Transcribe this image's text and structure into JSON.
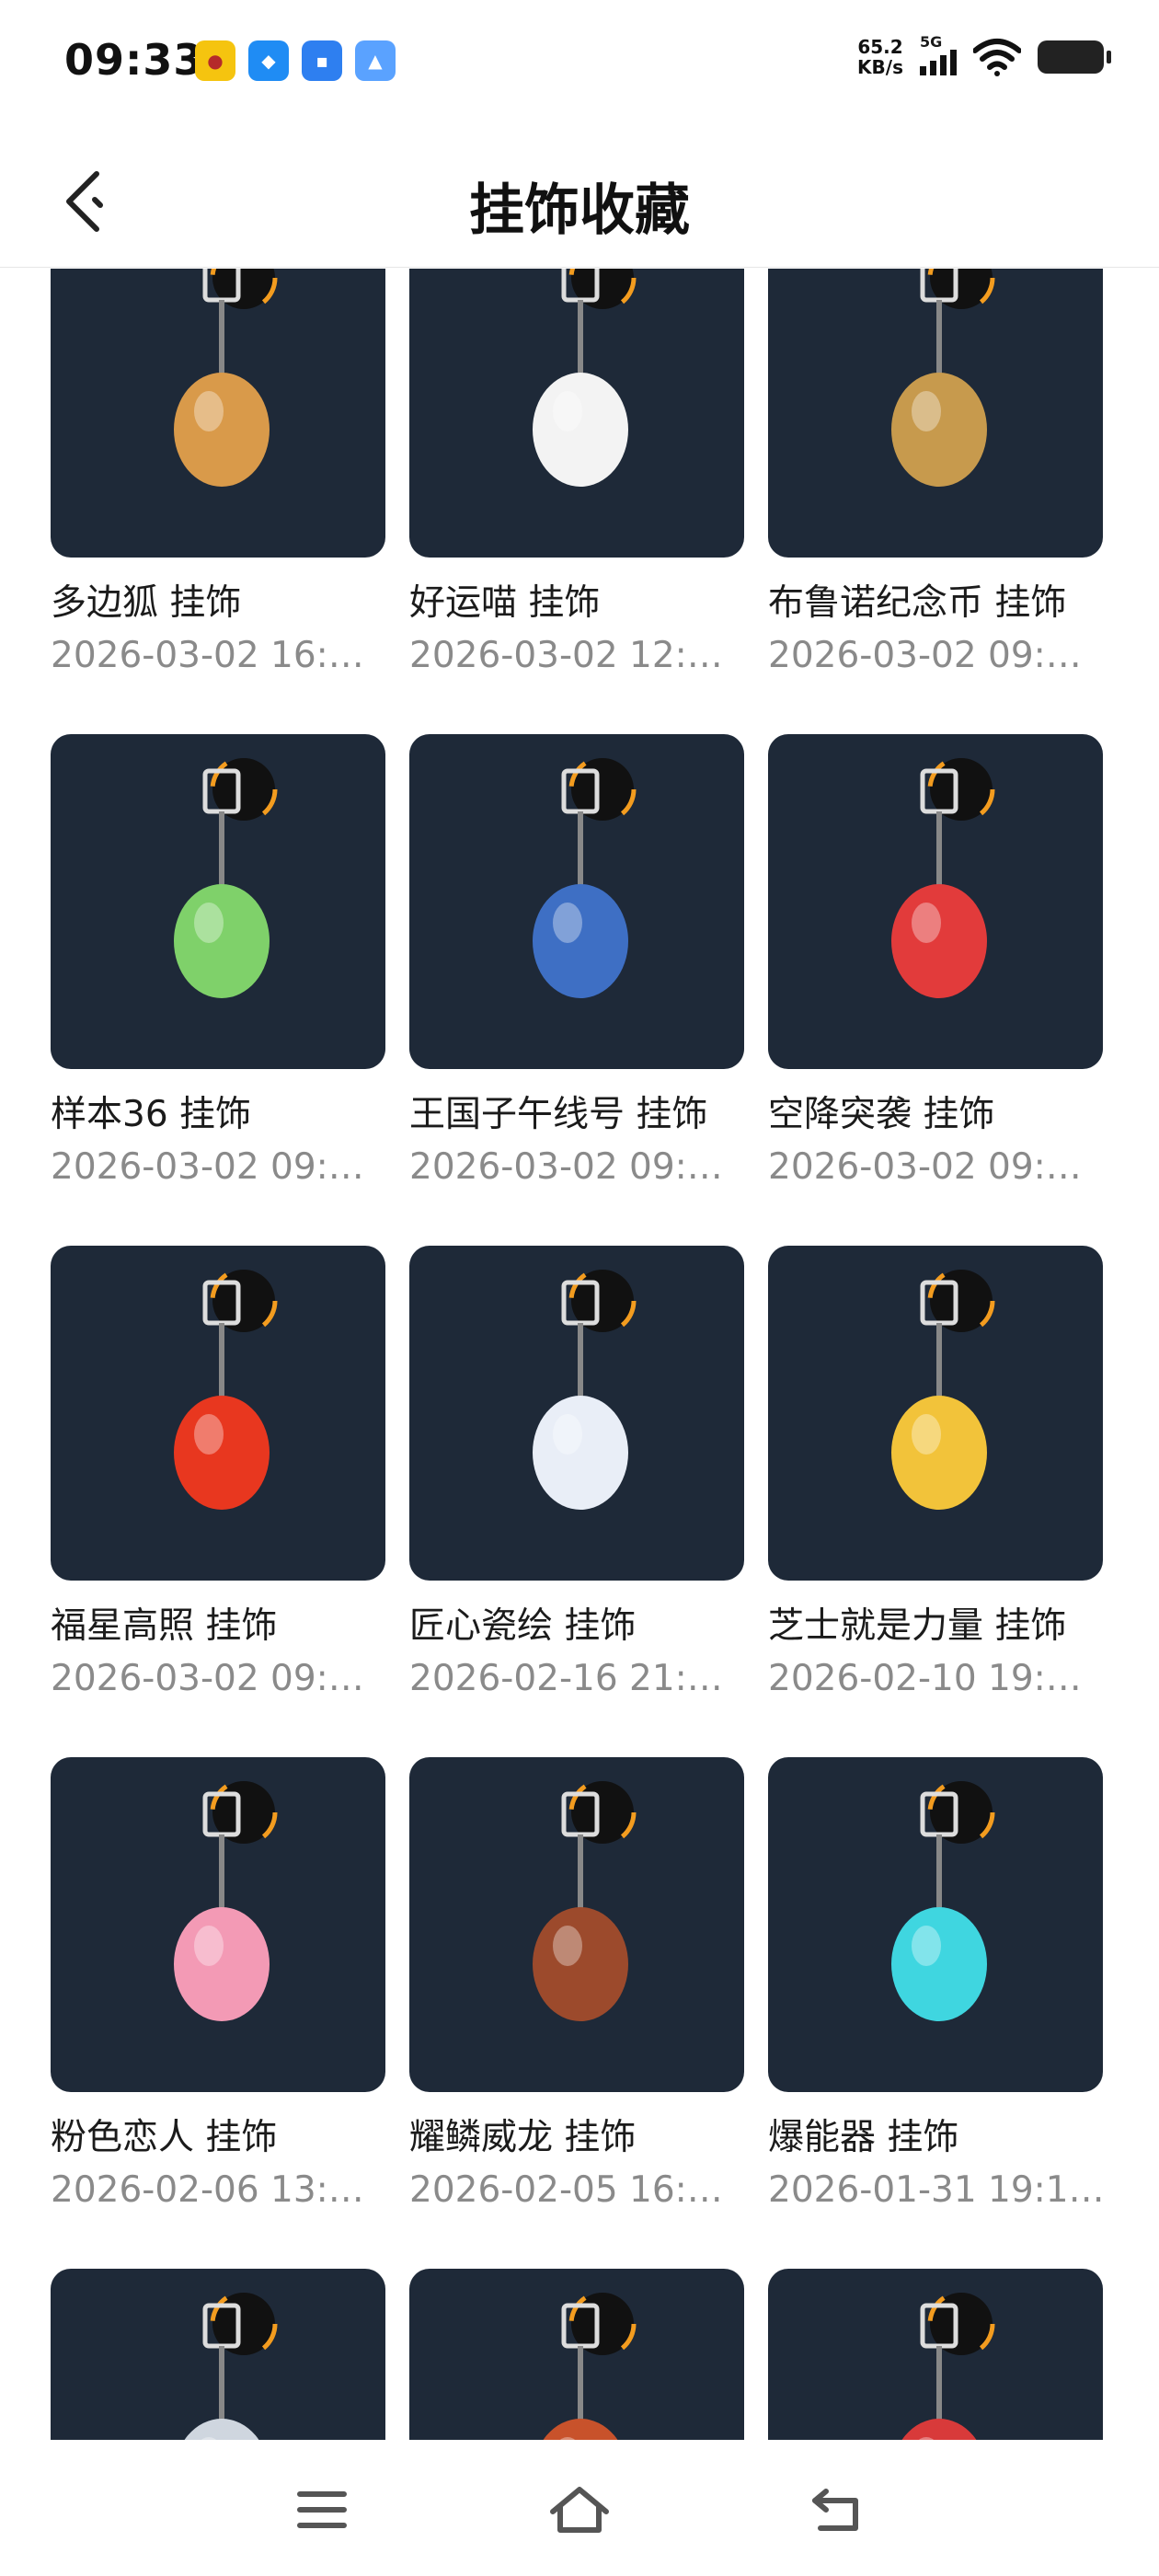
{
  "status_bar": {
    "time": "09:33",
    "net_speed_value": "65.2",
    "net_speed_unit": "KB/s",
    "network_label": "5G",
    "app_icons": [
      "game-app-icon",
      "du-app-icon",
      "chat-app-icon",
      "files-app-icon"
    ]
  },
  "header": {
    "title": "挂饰收藏",
    "back_icon": "back-arrow-icon"
  },
  "items": [
    {
      "name": "多边狐 挂饰",
      "time": "2026-03-02 16:…",
      "color": "#d99a4a"
    },
    {
      "name": "好运喵 挂饰",
      "time": "2026-03-02 12:…",
      "color": "#f3f3f3"
    },
    {
      "name": "布鲁诺纪念币 挂饰",
      "time": "2026-03-02 09:…",
      "color": "#c79a4d"
    },
    {
      "name": "样本36 挂饰",
      "time": "2026-03-02 09:…",
      "color": "#7fd16a"
    },
    {
      "name": "王国子午线号 挂饰",
      "time": "2026-03-02 09:…",
      "color": "#3e6fc4"
    },
    {
      "name": "空降突袭 挂饰",
      "time": "2026-03-02 09:…",
      "color": "#e23b3b"
    },
    {
      "name": "福星高照 挂饰",
      "time": "2026-03-02 09:…",
      "color": "#e8371f"
    },
    {
      "name": "匠心瓷绘 挂饰",
      "time": "2026-02-16 21:…",
      "color": "#e9eef7"
    },
    {
      "name": "芝士就是力量 挂饰",
      "time": "2026-02-10 19:…",
      "color": "#f2c33a"
    },
    {
      "name": "粉色恋人 挂饰",
      "time": "2026-02-06 13:…",
      "color": "#f39ab5"
    },
    {
      "name": "耀鳞威龙 挂饰",
      "time": "2026-02-05 16:…",
      "color": "#9c4a2c"
    },
    {
      "name": "爆能器 挂饰",
      "time": "2026-01-31 19:1…",
      "color": "#3fd6e0"
    },
    {
      "name": "",
      "time": "",
      "color": "#cfd6df"
    },
    {
      "name": "",
      "time": "",
      "color": "#c8522b"
    },
    {
      "name": "",
      "time": "",
      "color": "#d83a3a"
    }
  ],
  "nav": {
    "menu_icon": "menu-icon",
    "home_icon": "home-icon",
    "back_icon": "back-icon"
  },
  "colors": {
    "card_bg": "#1e2938",
    "accent_ring": "#f39c1f",
    "secondary_text": "#8a8a8a"
  }
}
